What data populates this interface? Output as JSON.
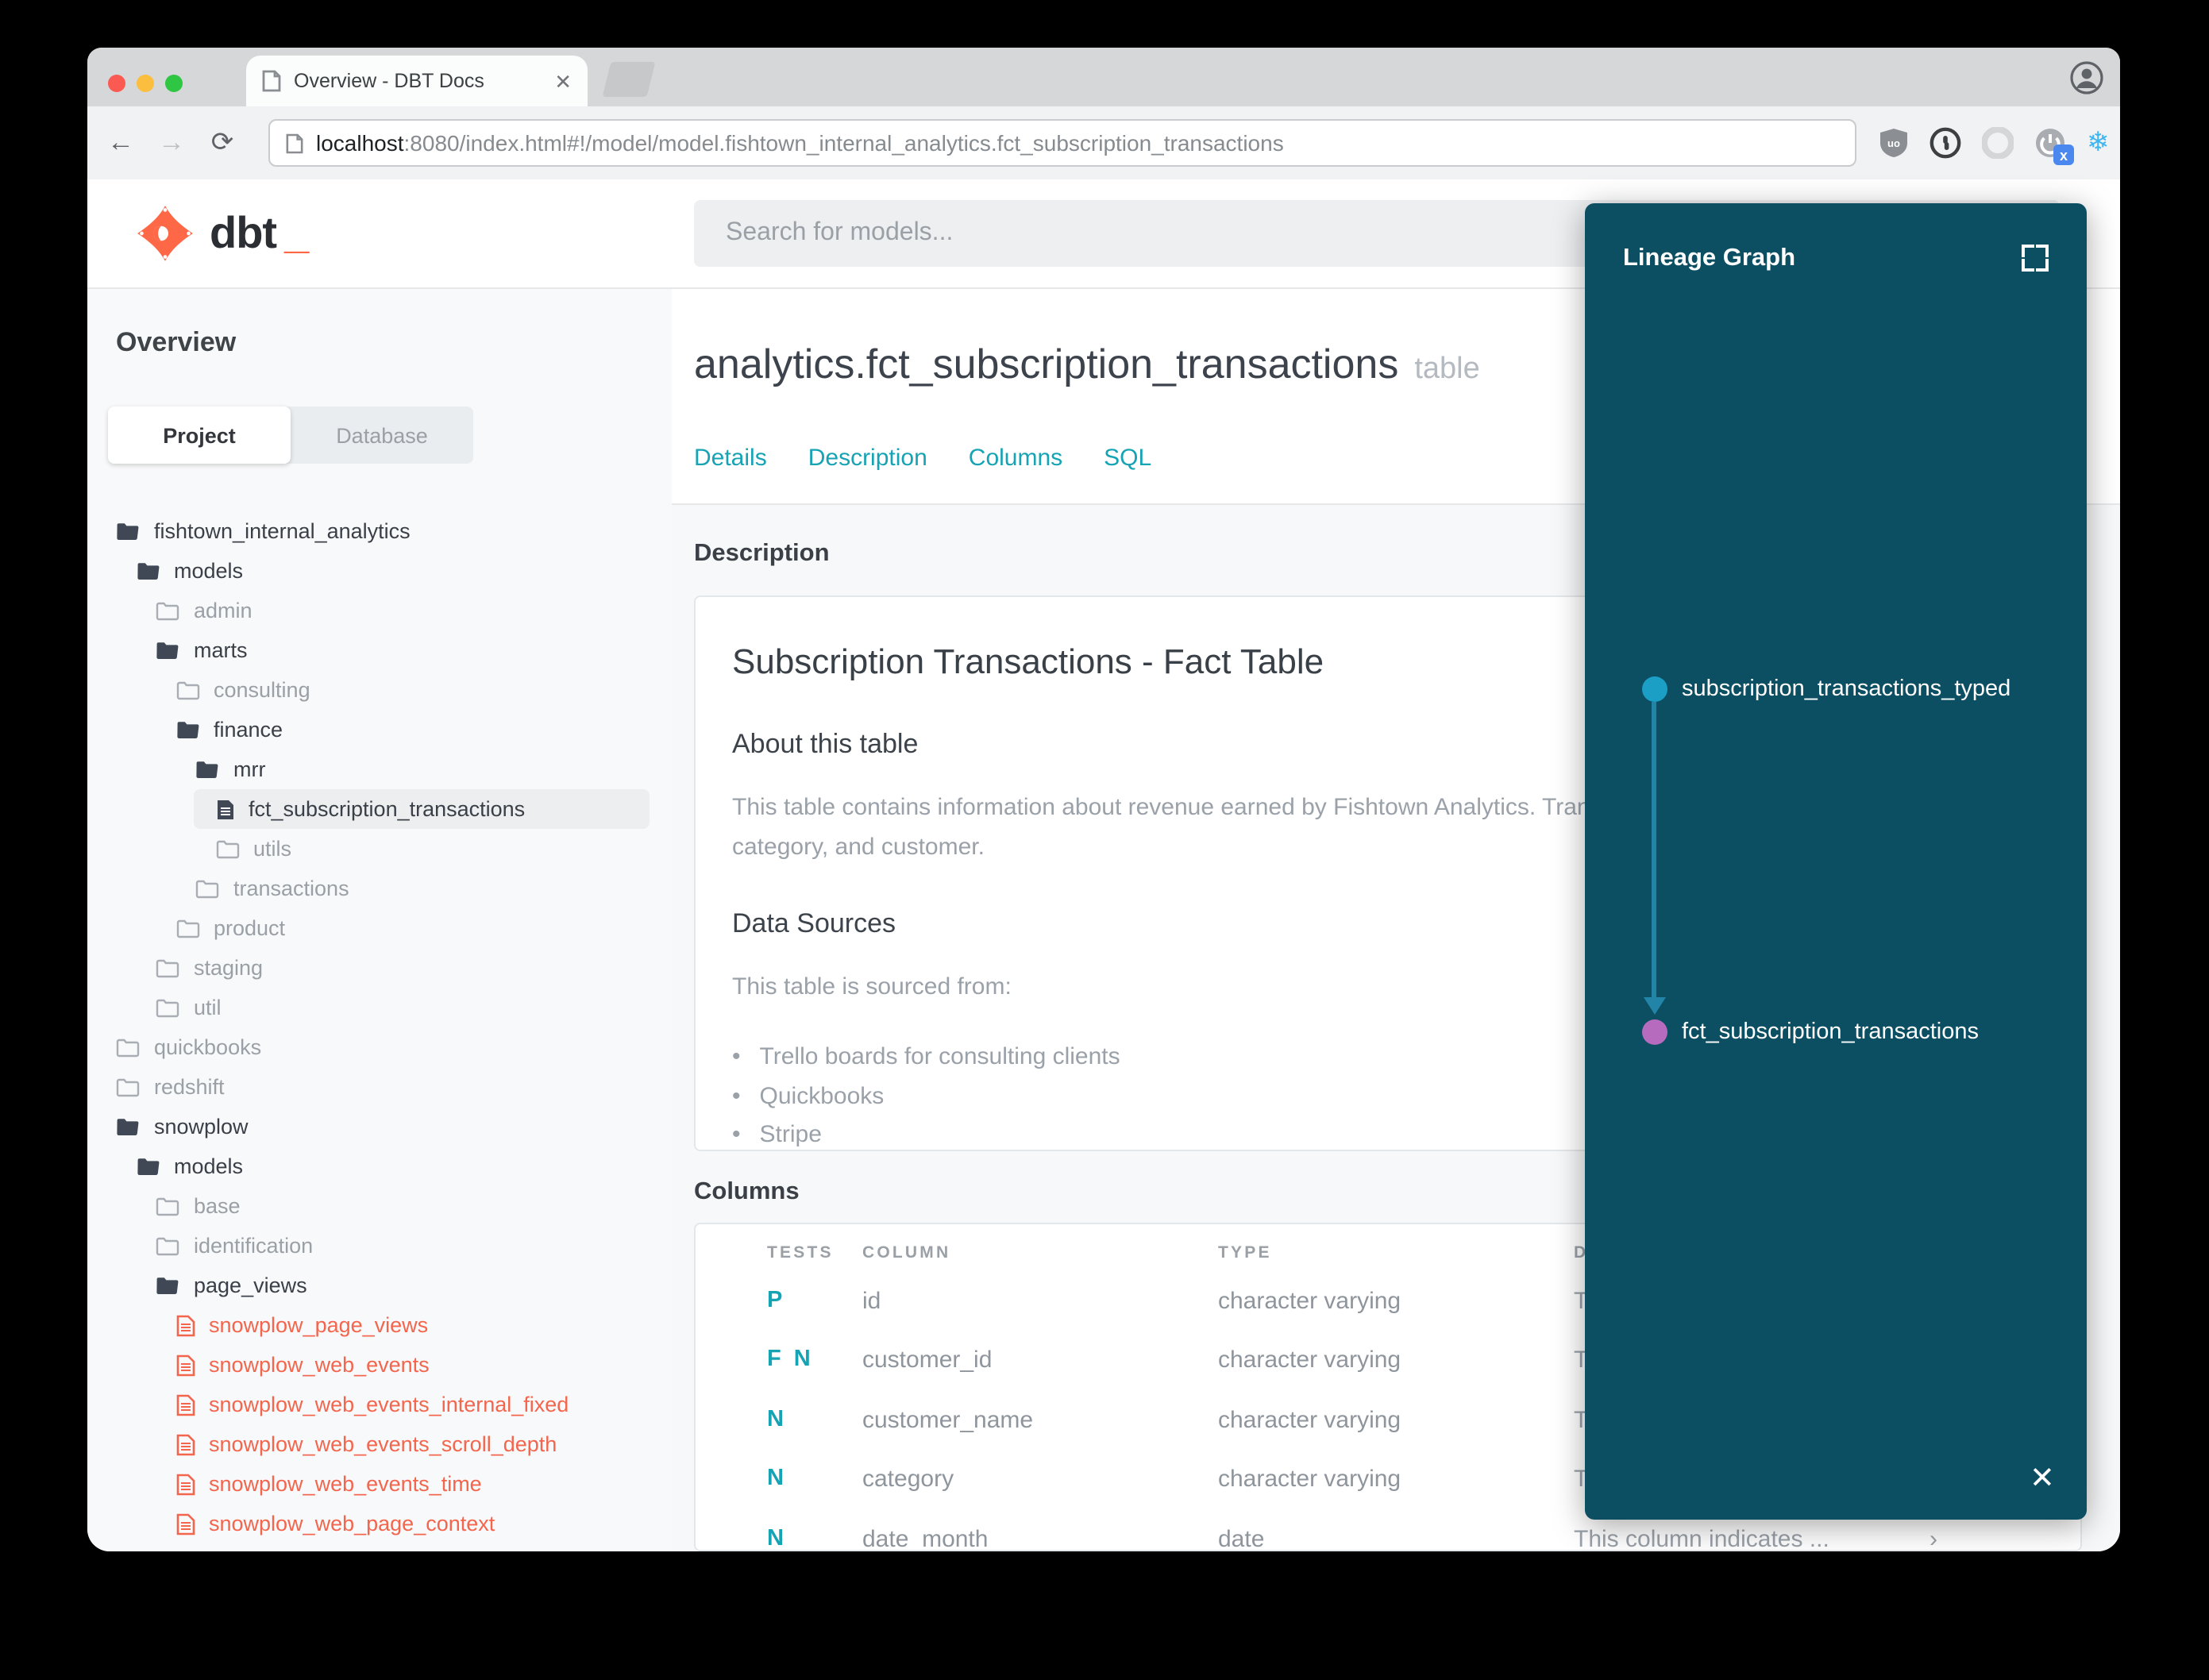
{
  "browser": {
    "tab_title": "Overview - DBT Docs",
    "url_host": "localhost",
    "url_rest": ":8080/index.html#!/model/model.fishtown_internal_analytics.fct_subscription_transactions",
    "extension_icons": [
      "ublock-shield-icon",
      "1password-icon",
      "opera-ring-icon",
      "power-blocker-icon",
      "snowflake-icon",
      "browser-menu-icon"
    ],
    "power_badge_letter": "x"
  },
  "header": {
    "logo_text": "dbt",
    "logo_underscore": "_",
    "search_placeholder": "Search for models..."
  },
  "sidebar": {
    "title": "Overview",
    "tabs": {
      "project": "Project",
      "database": "Database"
    },
    "tree": [
      {
        "label": "fishtown_internal_analytics",
        "level": 0,
        "icon": "folder-open"
      },
      {
        "label": "models",
        "level": 1,
        "icon": "folder-open"
      },
      {
        "label": "admin",
        "level": 2,
        "icon": "folder"
      },
      {
        "label": "marts",
        "level": 2,
        "icon": "folder-open"
      },
      {
        "label": "consulting",
        "level": 3,
        "icon": "folder"
      },
      {
        "label": "finance",
        "level": 3,
        "icon": "folder-open"
      },
      {
        "label": "mrr",
        "level": 4,
        "icon": "folder-open"
      },
      {
        "label": "fct_subscription_transactions",
        "level": 5,
        "icon": "file",
        "selected": true
      },
      {
        "label": "utils",
        "level": 5,
        "icon": "folder"
      },
      {
        "label": "transactions",
        "level": 4,
        "icon": "folder"
      },
      {
        "label": "product",
        "level": 3,
        "icon": "folder"
      },
      {
        "label": "staging",
        "level": 2,
        "icon": "folder"
      },
      {
        "label": "util",
        "level": 2,
        "icon": "folder"
      },
      {
        "label": "quickbooks",
        "level": 0,
        "icon": "folder"
      },
      {
        "label": "redshift",
        "level": 0,
        "icon": "folder"
      },
      {
        "label": "snowplow",
        "level": 0,
        "icon": "folder-open"
      },
      {
        "label": "models",
        "level": 1,
        "icon": "folder-open"
      },
      {
        "label": "base",
        "level": 2,
        "icon": "folder"
      },
      {
        "label": "identification",
        "level": 2,
        "icon": "folder"
      },
      {
        "label": "page_views",
        "level": 2,
        "icon": "folder-open"
      },
      {
        "label": "snowplow_page_views",
        "level": 3,
        "icon": "file-red"
      },
      {
        "label": "snowplow_web_events",
        "level": 3,
        "icon": "file-red"
      },
      {
        "label": "snowplow_web_events_internal_fixed",
        "level": 3,
        "icon": "file-red"
      },
      {
        "label": "snowplow_web_events_scroll_depth",
        "level": 3,
        "icon": "file-red"
      },
      {
        "label": "snowplow_web_events_time",
        "level": 3,
        "icon": "file-red"
      },
      {
        "label": "snowplow_web_page_context",
        "level": 3,
        "icon": "file-red"
      }
    ]
  },
  "main": {
    "title": "analytics.fct_subscription_transactions",
    "title_badge": "table",
    "nav_tabs": [
      "Details",
      "Description",
      "Columns",
      "SQL"
    ],
    "description_section": {
      "heading": "Description",
      "card_title": "Subscription Transactions - Fact Table",
      "about_heading": "About this table",
      "about_line1": "This table contains information about revenue earned by Fishtown Analytics. Transactions are grouped by month,",
      "about_line2": "category, and customer.",
      "sources_heading": "Data Sources",
      "sources_intro": "This table is sourced from:",
      "sources": [
        "Trello boards for consulting clients",
        "Quickbooks",
        "Stripe"
      ]
    },
    "columns_section": {
      "heading": "Columns",
      "table_headers": [
        "TESTS",
        "COLUMN",
        "TYPE",
        "DESCRIPTION"
      ],
      "rows": [
        {
          "tests": "P",
          "column": "id",
          "type": "character varying",
          "description": "This column indicates ..."
        },
        {
          "tests": "F N",
          "column": "customer_id",
          "type": "character varying",
          "description": "This column indicates ..."
        },
        {
          "tests": "N",
          "column": "customer_name",
          "type": "character varying",
          "description": "This column indicates ..."
        },
        {
          "tests": "N",
          "column": "category",
          "type": "character varying",
          "description": "This column indicates ..."
        },
        {
          "tests": "N",
          "column": "date_month",
          "type": "date",
          "description": "This column indicates ..."
        }
      ]
    }
  },
  "lineage": {
    "title": "Lineage Graph",
    "nodes": [
      {
        "label": "subscription_transactions_typed",
        "color": "#1b9fc4"
      },
      {
        "label": "fct_subscription_transactions",
        "color": "#b66bbf"
      }
    ],
    "close_glyph": "✕"
  },
  "colors": {
    "accent_teal": "#16a3b4",
    "brand_orange": "#ff6847",
    "file_red": "#f4654d",
    "lineage_bg": "#0c4f63",
    "edge_blue": "#2284a6",
    "traffic_red": "#fb5a52",
    "traffic_yellow": "#fcbe3e",
    "traffic_green": "#2fc643"
  }
}
